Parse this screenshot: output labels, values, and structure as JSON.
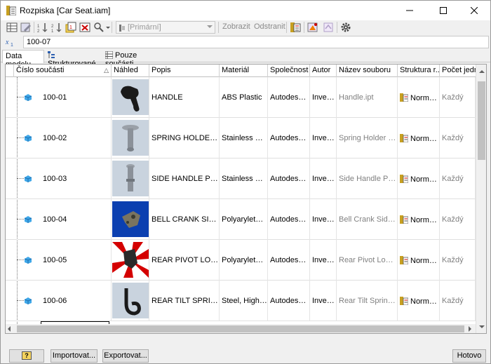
{
  "window": {
    "title": "Rozpiska [Car Seat.iam]"
  },
  "toolbar": {
    "view_combo_value": "[Primární]",
    "show_label": "Zobrazit",
    "remove_label": "Odstranit"
  },
  "expression": {
    "value": "100-07"
  },
  "tabs": [
    {
      "label": "Data modelu"
    },
    {
      "label": "Strukturované"
    },
    {
      "label": "Pouze součásti"
    }
  ],
  "columns": {
    "part_number": "Číslo součásti",
    "preview": "Náhled",
    "description": "Popis",
    "material": "Materiál",
    "company": "Společnost",
    "author": "Autor",
    "file_name": "Název souboru",
    "structure": "Struktura r...",
    "units": "Počet jednotek"
  },
  "rows": [
    {
      "part_number": "100-01",
      "description": "HANDLE",
      "material": "ABS Plastic",
      "company": "Autodesk Inc.",
      "author": "Inventor",
      "file_name": "Handle.ipt",
      "structure": "Normální",
      "units": "Každý"
    },
    {
      "part_number": "100-02",
      "description": "SPRING HOLDER PIN",
      "material": "Stainless Steel",
      "company": "Autodesk Inc.",
      "author": "Inventor",
      "file_name": "Spring Holder Pin.ipt",
      "structure": "Normální",
      "units": "Každý"
    },
    {
      "part_number": "100-03",
      "description": "SIDE HANDLE PIVOT ...",
      "material": "Stainless Steel",
      "company": "Autodesk Inc.",
      "author": "Inventor",
      "file_name": "Side Handle Pivot ...",
      "structure": "Normální",
      "units": "Každý"
    },
    {
      "part_number": "100-04",
      "description": "BELL CRANK SIDE HA...",
      "material": "Polyarylether...",
      "company": "Autodesk Inc.",
      "author": "Inventor",
      "file_name": "Bell Crank Side Ha...",
      "structure": "Normální",
      "units": "Každý"
    },
    {
      "part_number": "100-05",
      "description": "REAR PIVOT LOCK PL...",
      "material": "Polyarylether...",
      "company": "Autodesk Inc.",
      "author": "Inventor",
      "file_name": "Rear Pivot Lock Pl...",
      "structure": "Normální",
      "units": "Každý"
    },
    {
      "part_number": "100-06",
      "description": "REAR TILT SPRING",
      "material": "Steel, High St...",
      "company": "Autodesk Inc.",
      "author": "Inventor",
      "file_name": "Rear Tilt Spring.ipt",
      "structure": "Normální",
      "units": "Každý"
    }
  ],
  "buttons": {
    "help": "?",
    "import": "Importovat...",
    "export": "Exportovat...",
    "done": "Hotovo"
  }
}
